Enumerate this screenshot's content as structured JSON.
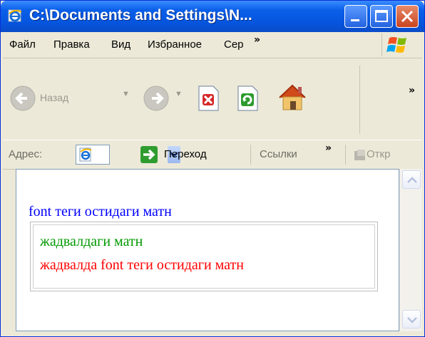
{
  "window": {
    "title": "C:\\Documents and Settings\\N..."
  },
  "menu": {
    "items": [
      "Файл",
      "Правка",
      "Вид",
      "Избранное",
      "Сер"
    ],
    "more": "»"
  },
  "toolbar": {
    "back_label": "Назад",
    "more": "»"
  },
  "address": {
    "label": "Адрес:",
    "go_label": "Переход",
    "links_label": "Ссылки",
    "links_more": "»",
    "open_label": "Откр"
  },
  "page": {
    "text": "font теги остидаги матн",
    "text_color": "#0000ff",
    "table": {
      "row1": "жадвалдаги матн",
      "row1_color": "#009900",
      "row2": "жадвалда font теги остидаги матн",
      "row2_color": "#ff0000"
    }
  },
  "icons": {
    "title": "ie-icon",
    "stop": "stop-icon",
    "refresh": "refresh-icon",
    "home": "home-icon",
    "go": "go-arrow-icon",
    "address_page": "ie-page-icon"
  }
}
